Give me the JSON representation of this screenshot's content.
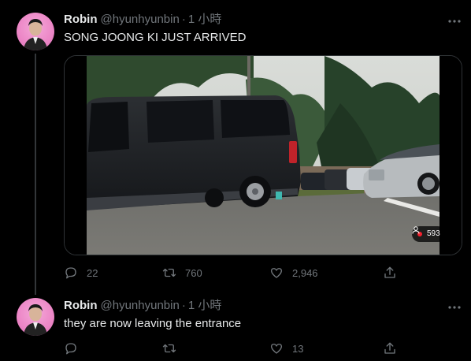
{
  "tweets": [
    {
      "author_name": "Robin",
      "handle": "@hyunhyunbin",
      "separator": "·",
      "time": "1 小時",
      "text": "SONG JOONG KI JUST ARRIVED",
      "media": {
        "view_count": "593"
      },
      "replies": "22",
      "retweets": "760",
      "likes": "2,946"
    },
    {
      "author_name": "Robin",
      "handle": "@hyunhyunbin",
      "separator": "·",
      "time": "1 小時",
      "text": "they are now leaving the entrance",
      "replies": "",
      "retweets": "",
      "likes": "13"
    }
  ],
  "colors": {
    "background": "#000000",
    "text_primary": "#e7e9ea",
    "text_secondary": "#71767b",
    "avatar_bg": "#ec86c6",
    "live_dot": "#f4212e"
  },
  "icons": [
    "more-icon",
    "reply-icon",
    "retweet-icon",
    "like-icon",
    "share-icon",
    "person-icon"
  ]
}
